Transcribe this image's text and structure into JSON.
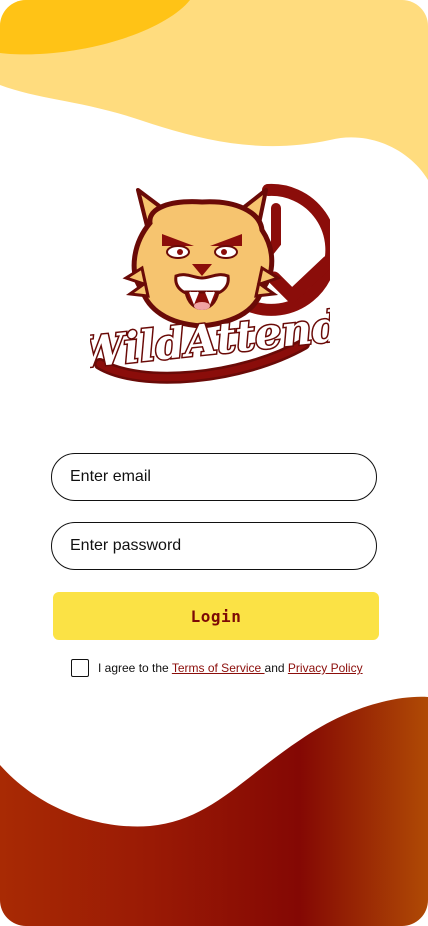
{
  "app": {
    "logo_text": "WildAttend"
  },
  "form": {
    "email_placeholder": "Enter email",
    "password_placeholder": "Enter password",
    "login_label": "Login"
  },
  "terms": {
    "prefix": "I agree to the ",
    "terms_link": "Terms of Service ",
    "conjunction": "and ",
    "privacy_link": "Privacy Policy",
    "checked": false
  },
  "colors": {
    "accent_yellow": "#fbe245",
    "header_yellow": "#ffdc7e",
    "deep_yellow": "#ffc316",
    "brand_maroon": "#8b0d0a",
    "burnt_orange": "#a93a06"
  },
  "icons": [
    "checkmark-icon",
    "clock-icon",
    "wildcat-mascot"
  ]
}
